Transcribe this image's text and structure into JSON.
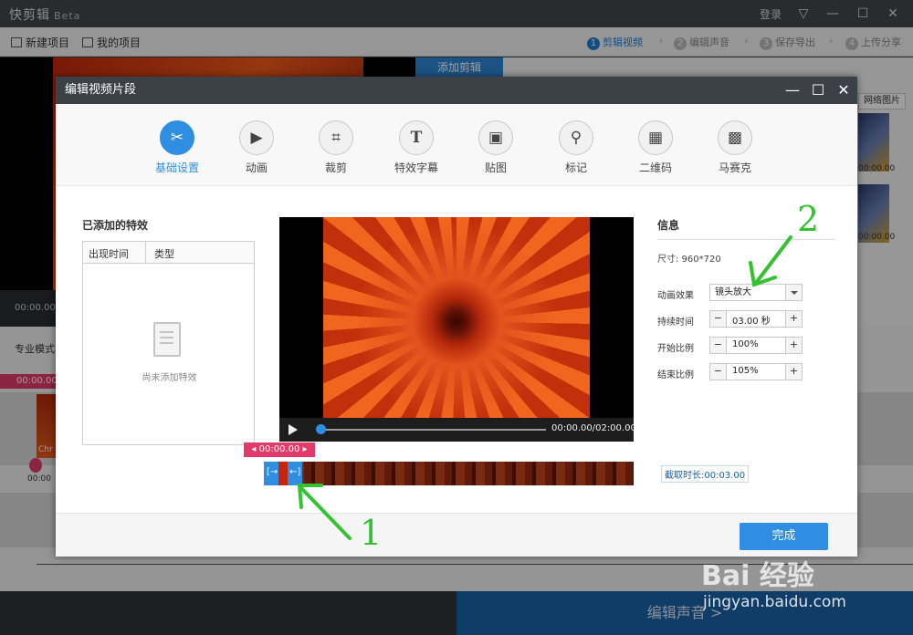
{
  "app": {
    "logo": "快剪辑",
    "beta": "Beta",
    "login": "登录"
  },
  "toolbar": {
    "new_project": "新建项目",
    "my_projects": "我的项目",
    "steps": [
      {
        "num": "1",
        "label": "剪辑视频"
      },
      {
        "num": "2",
        "label": "编辑声音"
      },
      {
        "num": "3",
        "label": "保存导出"
      },
      {
        "num": "4",
        "label": "上传分享"
      }
    ]
  },
  "background": {
    "add_clip": "添加剪辑",
    "net_image": "网络图片",
    "thumb_time_1": "00:00.00",
    "thumb_time_2": "00:00.00",
    "left_time": "00:00.00",
    "pro_mode": "专业模式",
    "timeline_head": "00:00.00",
    "clip_label": "Chr",
    "pin_time": "00:00",
    "next_button": "编辑声音 >"
  },
  "dialog": {
    "title": "编辑视频片段",
    "tabs": [
      {
        "label": "基础设置",
        "icon": "scissors-icon",
        "glyph": "✂"
      },
      {
        "label": "动画",
        "icon": "play-box-icon",
        "glyph": "▶"
      },
      {
        "label": "裁剪",
        "icon": "crop-icon",
        "glyph": "⌗"
      },
      {
        "label": "特效字幕",
        "icon": "text-icon",
        "glyph": "T"
      },
      {
        "label": "贴图",
        "icon": "image-icon",
        "glyph": "▣"
      },
      {
        "label": "标记",
        "icon": "pin-icon",
        "glyph": "⚲"
      },
      {
        "label": "二维码",
        "icon": "qrcode-icon",
        "glyph": "▦"
      },
      {
        "label": "马赛克",
        "icon": "mosaic-icon",
        "glyph": "▩"
      }
    ],
    "effects": {
      "title": "已添加的特效",
      "col_time": "出现时间",
      "col_type": "类型",
      "empty": "尚未添加特效"
    },
    "player": {
      "time": "00:00.00/02:00.00",
      "head_time": "00:00.00",
      "cut_duration": "截取时长:00:03.00"
    },
    "info": {
      "title": "信息",
      "size": "尺寸: 960*720",
      "anim_label": "动画效果",
      "anim_value": "镜头放大",
      "duration_label": "持续时间",
      "duration_value": "03.00 秒",
      "start_label": "开始比例",
      "start_value": "100%",
      "end_label": "结束比例",
      "end_value": "105%"
    },
    "done": "完成"
  },
  "annotations": {
    "label_1": "1",
    "label_2": "2",
    "arrow_color": "#34c232"
  },
  "watermark": {
    "logo": "Bai 经验",
    "url": "jingyan.baidu.com"
  },
  "colors": {
    "accent": "#2f8ee2",
    "marker": "#e13a6b"
  }
}
